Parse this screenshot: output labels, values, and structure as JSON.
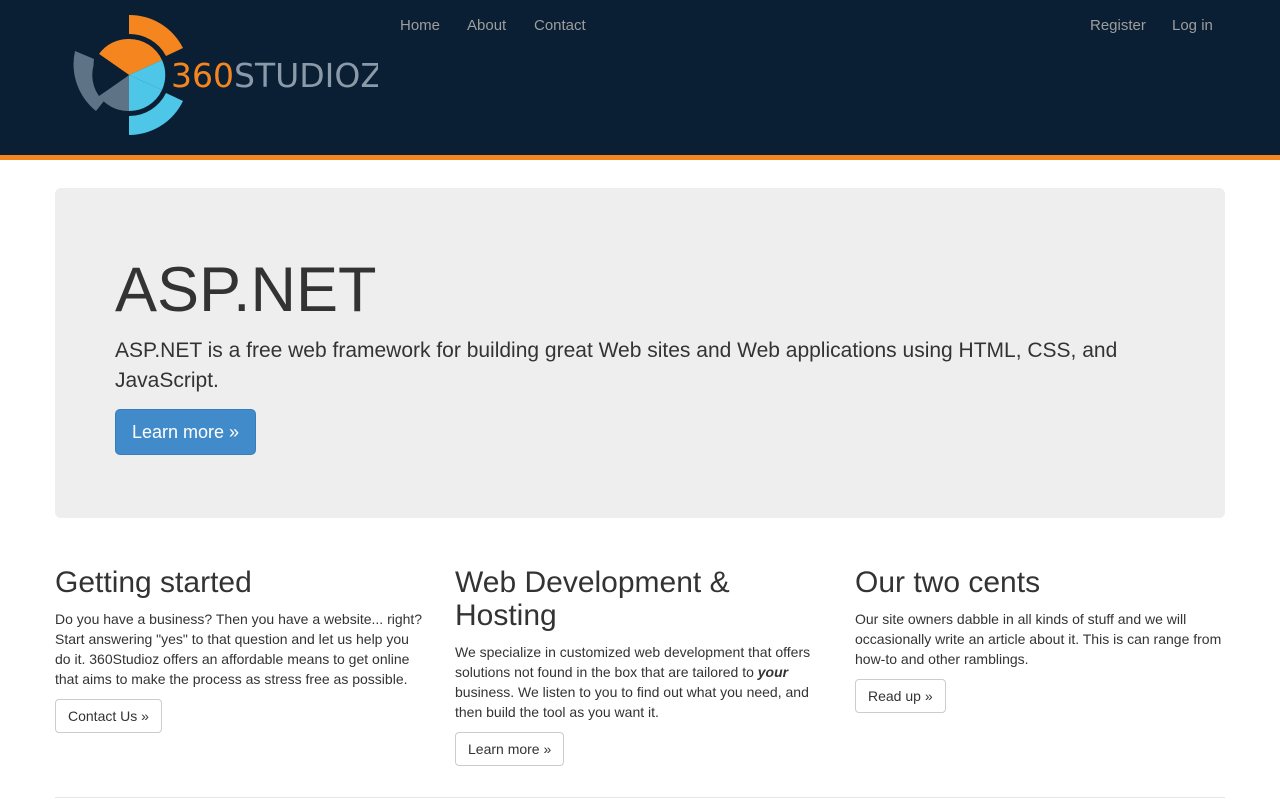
{
  "brand": {
    "logo_text_accent": "360",
    "logo_text_main": "STUDIOZ",
    "colors": {
      "orange": "#f5861f",
      "cyan": "#4ec6e8",
      "slate": "#5f7386",
      "navbar": "#0a1f33"
    }
  },
  "nav": {
    "left_items": [
      {
        "label": "Home"
      },
      {
        "label": "About"
      },
      {
        "label": "Contact"
      }
    ],
    "right_items": [
      {
        "label": "Register"
      },
      {
        "label": "Log in"
      }
    ]
  },
  "jumbotron": {
    "title": "ASP.NET",
    "lead": "ASP.NET is a free web framework for building great Web sites and Web applications using HTML, CSS, and JavaScript.",
    "button_label": "Learn more »"
  },
  "columns": [
    {
      "heading": "Getting started",
      "body": "Do you have a business? Then you have a website... right? Start answering \"yes\" to that question and let us help you do it. 360Studioz offers an affordable means to get online that aims to make the process as stress free as possible.",
      "button_label": "Contact Us »"
    },
    {
      "heading": "Web Development & Hosting",
      "body_before": "We specialize in customized web development that offers solutions not found in the box that are tailored to ",
      "body_emphasis": "your",
      "body_after": " business. We listen to you to find out what you need, and then build the tool as you want it.",
      "button_label": "Learn more »"
    },
    {
      "heading": "Our two cents",
      "body": "Our site owners dabble in all kinds of stuff and we will occasionally write an article about it. This is can range from how-to and other ramblings.",
      "button_label": "Read up »"
    }
  ]
}
